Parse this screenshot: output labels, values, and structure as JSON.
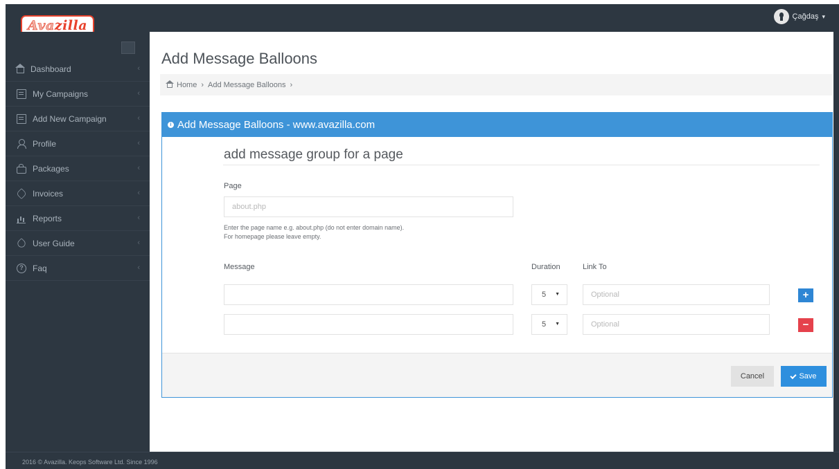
{
  "brand": {
    "logo_part1": "Ava",
    "logo_part2": "zilla"
  },
  "user": {
    "name": "Çağdaş"
  },
  "sidebar": {
    "items": [
      {
        "label": "Dashboard",
        "icon": "home-icon"
      },
      {
        "label": "My Campaigns",
        "icon": "campaigns-icon"
      },
      {
        "label": "Add New Campaign",
        "icon": "add-campaign-icon"
      },
      {
        "label": "Profile",
        "icon": "user-icon"
      },
      {
        "label": "Packages",
        "icon": "bag-icon"
      },
      {
        "label": "Invoices",
        "icon": "tag-icon"
      },
      {
        "label": "Reports",
        "icon": "bar-chart-icon"
      },
      {
        "label": "User Guide",
        "icon": "guide-icon"
      },
      {
        "label": "Faq",
        "icon": "question-icon"
      }
    ]
  },
  "page": {
    "title": "Add Message Balloons"
  },
  "breadcrumb": {
    "home": "Home",
    "current": "Add Message Balloons"
  },
  "panel": {
    "title": "Add Message Balloons - www.avazilla.com",
    "form_title": "add message group for a page",
    "page_label": "Page",
    "page_placeholder": "about.php",
    "help_line1": "Enter the page name e.g. about.php (do not enter domain name).",
    "help_line2": "For homepage please leave empty.",
    "message_label": "Message",
    "duration_label": "Duration",
    "link_label": "Link To",
    "rows": [
      {
        "duration": "5",
        "link_placeholder": "Optional",
        "action": "+"
      },
      {
        "duration": "5",
        "link_placeholder": "Optional",
        "action": "−"
      }
    ],
    "cancel_label": "Cancel",
    "save_label": "Save"
  },
  "footer": {
    "text": "2016 © Avazilla. Keops Software Ltd. Since 1996"
  },
  "colors": {
    "accent": "#3e94d8",
    "sidebar_bg": "#2d3741",
    "danger": "#e5424c",
    "brand": "#e8422c"
  }
}
